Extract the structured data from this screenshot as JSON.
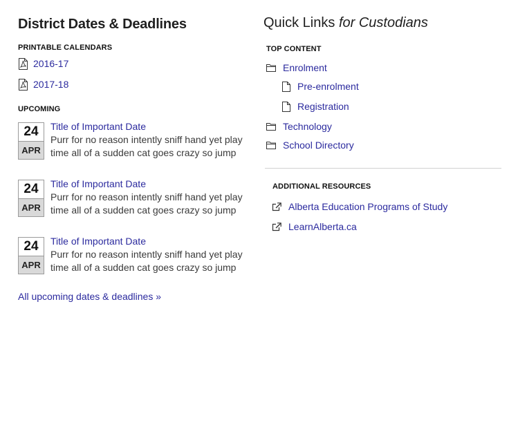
{
  "left": {
    "title": "District Dates & Deadlines",
    "printable_label": "PRINTABLE CALENDARS",
    "calendars": [
      {
        "label": "2016-17",
        "icon": "pdf-icon"
      },
      {
        "label": "2017-18",
        "icon": "pdf-icon"
      }
    ],
    "upcoming_label": "UPCOMING",
    "events": [
      {
        "day": "24",
        "month": "APR",
        "title": "Title of Important Date",
        "desc_line1": "Purr for no reason intently sniff hand yet play",
        "desc_line2": "time all of a sudden cat goes crazy so jump"
      },
      {
        "day": "24",
        "month": "APR",
        "title": "Title of Important Date",
        "desc_line1": "Purr for no reason intently sniff hand yet play",
        "desc_line2": "time all of a sudden cat goes crazy so jump"
      },
      {
        "day": "24",
        "month": "APR",
        "title": "Title of Important Date",
        "desc_line1": "Purr for no reason intently sniff hand yet play",
        "desc_line2": "time all of a sudden cat goes crazy so jump"
      }
    ],
    "all_link": "All upcoming dates & deadlines »"
  },
  "right": {
    "title_main": "Quick Links",
    "title_em": "for Custodians",
    "top_label": "TOP CONTENT",
    "top_items": [
      {
        "label": "Enrolment",
        "icon": "folder-icon"
      },
      {
        "label": "Pre-enrolment",
        "icon": "document-icon"
      },
      {
        "label": "Registration",
        "icon": "document-icon"
      },
      {
        "label": "Technology",
        "icon": "folder-icon"
      },
      {
        "label": "School Directory",
        "icon": "folder-icon"
      }
    ],
    "additional_label": "ADDITIONAL RESOURCES",
    "resources": [
      {
        "label": "Alberta Education Programs of Study",
        "icon": "external-link-icon"
      },
      {
        "label": "LearnAlberta.ca",
        "icon": "external-link-icon"
      }
    ]
  },
  "colors": {
    "link": "#2b2a9e",
    "date_month_bg": "#d9d9d9",
    "text": "#222222"
  }
}
